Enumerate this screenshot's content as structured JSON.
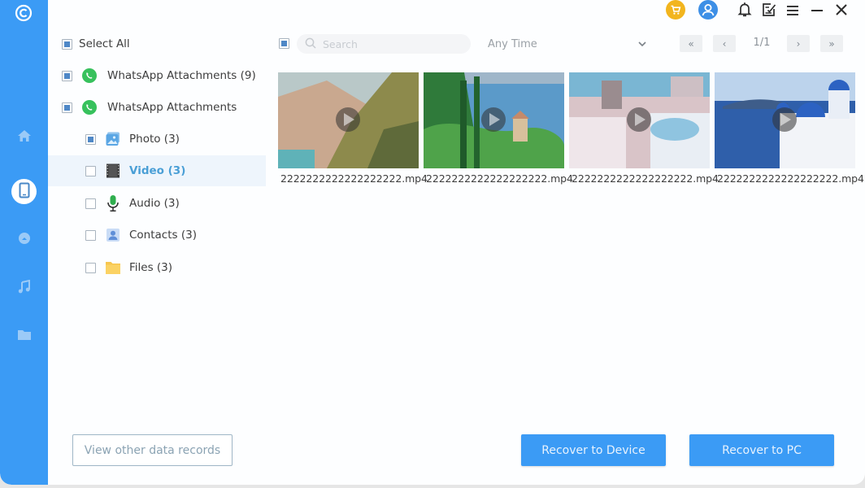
{
  "sidebar": {
    "items": [
      {
        "name": "home",
        "icon": "home-icon"
      },
      {
        "name": "device",
        "icon": "tablet-icon",
        "active": true
      },
      {
        "name": "cloud",
        "icon": "cloud-icon"
      },
      {
        "name": "music",
        "icon": "music-note-icon"
      },
      {
        "name": "files",
        "icon": "folder-icon"
      }
    ]
  },
  "topbar": {
    "icons": [
      "cart-icon",
      "user-icon",
      "bell-icon",
      "feedback-icon",
      "menu-icon",
      "minimize-icon",
      "close-icon"
    ]
  },
  "tree": {
    "select_all": "Select All",
    "items": [
      {
        "label": "WhatsApp Attachments (9)",
        "checked": true,
        "icon": "whatsapp-icon",
        "level": 0
      },
      {
        "label": "WhatsApp Attachments",
        "checked": true,
        "icon": "whatsapp-icon",
        "level": 0
      },
      {
        "label": "Photo (3)",
        "checked": true,
        "icon": "photo-icon",
        "level": 1
      },
      {
        "label": "Video (3)",
        "checked": false,
        "icon": "video-icon",
        "level": 1,
        "selected": true
      },
      {
        "label": "Audio (3)",
        "checked": false,
        "icon": "microphone-icon",
        "level": 1
      },
      {
        "label": "Contacts (3)",
        "checked": false,
        "icon": "contact-icon",
        "level": 1
      },
      {
        "label": "Files (3)",
        "checked": false,
        "icon": "folder-icon",
        "level": 1
      }
    ]
  },
  "toolbar": {
    "search_placeholder": "Search",
    "search_value": "",
    "time_filter": "Any Time",
    "page_indicator": "1/1",
    "first_label": "«",
    "prev_label": "‹",
    "next_label": "›",
    "last_label": "»"
  },
  "files": [
    {
      "name": "2222222222222222222.mp4",
      "scene": "coastal-village",
      "colors": [
        "#b9c8c8",
        "#c9a88f",
        "#8d8a4c",
        "#5f6a3a"
      ]
    },
    {
      "name": "2222222222222222222.mp4",
      "scene": "lake-garden",
      "colors": [
        "#5b9ac9",
        "#2f7a3a",
        "#4fa34a",
        "#c48a6a"
      ]
    },
    {
      "name": "2222222222222222222.mp4",
      "scene": "santorini-houses",
      "colors": [
        "#7ab6d3",
        "#d9c4c8",
        "#efe6ea",
        "#9a8c8f"
      ]
    },
    {
      "name": "2222222222222222222.mp4",
      "scene": "blue-domes",
      "colors": [
        "#2f5faa",
        "#bcd3ec",
        "#2c62c2",
        "#f2f4f8"
      ]
    }
  ],
  "actions": {
    "view_other": "View other data records",
    "recover_device": "Recover to Device",
    "recover_pc": "Recover to PC"
  }
}
